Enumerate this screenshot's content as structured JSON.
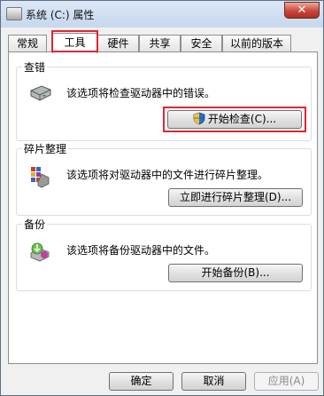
{
  "window": {
    "title": "系统 (C:) 属性",
    "close_label": "✕"
  },
  "tabs": [
    {
      "label": "常规",
      "active": false
    },
    {
      "label": "工具",
      "active": true
    },
    {
      "label": "硬件",
      "active": false
    },
    {
      "label": "共享",
      "active": false
    },
    {
      "label": "安全",
      "active": false
    },
    {
      "label": "以前的版本",
      "active": false
    }
  ],
  "groups": {
    "check": {
      "title": "查错",
      "description": "该选项将检查驱动器中的错误。",
      "button_label": "开始检查(C)...",
      "icon": "drive-icon"
    },
    "defrag": {
      "title": "碎片整理",
      "description": "该选项将对驱动器中的文件进行碎片整理。",
      "button_label": "立即进行碎片整理(D)...",
      "icon": "defrag-icon"
    },
    "backup": {
      "title": "备份",
      "description": "该选项将备份驱动器中的文件。",
      "button_label": "开始备份(B)...",
      "icon": "backup-icon"
    }
  },
  "footer": {
    "ok_label": "确定",
    "cancel_label": "取消",
    "apply_label": "应用(A)",
    "apply_disabled": true
  },
  "colors": {
    "highlight": "#e0262d",
    "title_bar": "#c6d8ee",
    "panel": "#ffffff"
  }
}
